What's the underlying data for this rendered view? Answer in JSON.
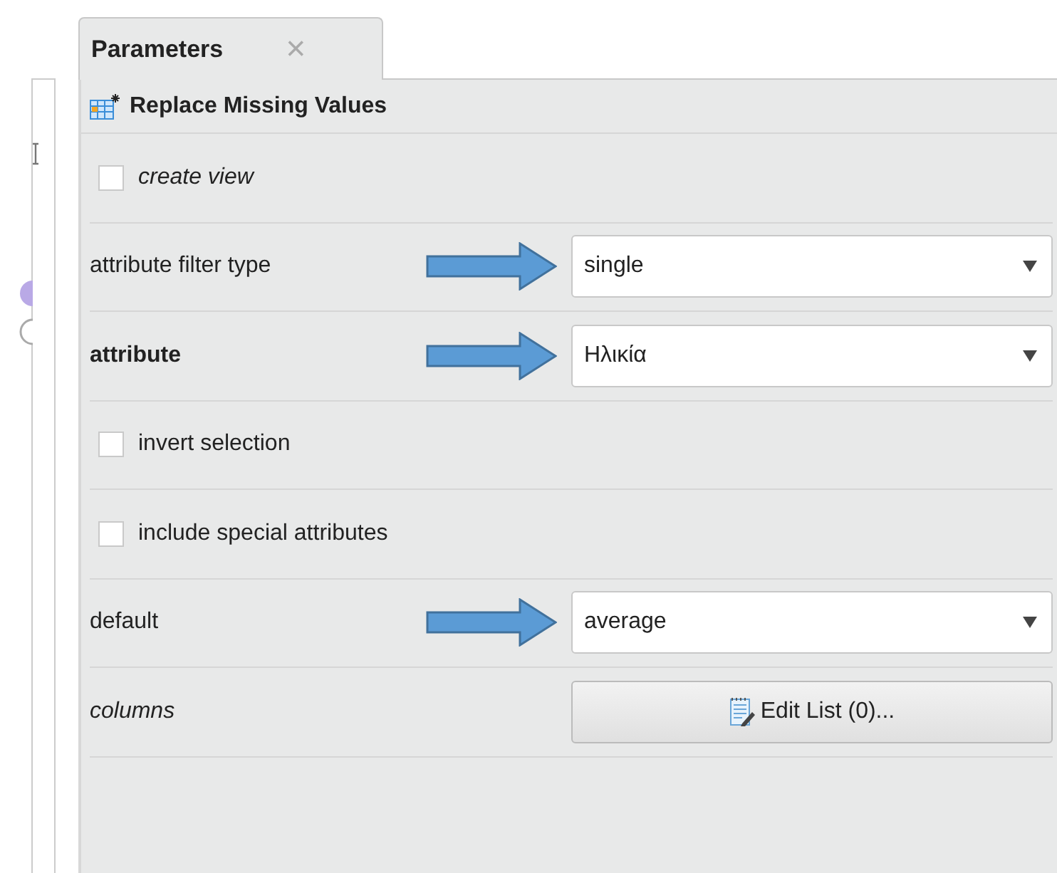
{
  "tab": {
    "label": "Parameters",
    "close": "×",
    "selected": true
  },
  "operator": {
    "title": "Replace Missing Values"
  },
  "parameters": [
    {
      "kind": "checkbox",
      "label": "create view",
      "italic": true,
      "bold": false,
      "checked": false
    },
    {
      "kind": "select",
      "label": "attribute filter type",
      "italic": false,
      "bold": false,
      "value": "single",
      "arrow": true
    },
    {
      "kind": "select",
      "label": "attribute",
      "italic": false,
      "bold": true,
      "value": "Ηλικία",
      "arrow": true
    },
    {
      "kind": "checkbox",
      "label": "invert selection",
      "italic": false,
      "bold": false,
      "checked": false
    },
    {
      "kind": "checkbox",
      "label": "include special attributes",
      "italic": false,
      "bold": false,
      "checked": false
    },
    {
      "kind": "select",
      "label": "default",
      "italic": false,
      "bold": false,
      "value": "average",
      "arrow": true
    },
    {
      "kind": "button",
      "label": "columns",
      "italic": true,
      "bold": false,
      "value": "Edit List (0)..."
    }
  ]
}
